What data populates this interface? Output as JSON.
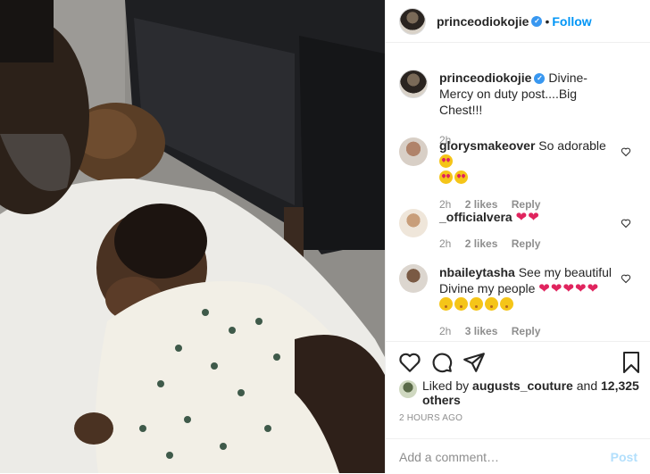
{
  "header": {
    "username": "princeodiokojie",
    "verified_icon": "verified-badge-icon",
    "separator": "•",
    "follow_label": "Follow"
  },
  "caption": {
    "username": "princeodiokojie",
    "text": "Divine-Mercy on duty post....Big Chest!!!",
    "time": "2h"
  },
  "comments": [
    {
      "username": "glorysmakeover",
      "text": "So adorable",
      "emoji": [
        "heart-eyes-emoji",
        "heart-eyes-emoji",
        "heart-eyes-emoji"
      ],
      "time": "2h",
      "likes": "2 likes",
      "reply": "Reply"
    },
    {
      "username": "_officialvera",
      "text": "",
      "emoji": [
        "red-heart-emoji",
        "red-heart-emoji"
      ],
      "time": "2h",
      "likes": "2 likes",
      "reply": "Reply"
    },
    {
      "username": "nbaileytasha",
      "text": "See my beautiful Divine my people",
      "emoji": [
        "red-heart-emoji",
        "red-heart-emoji",
        "red-heart-emoji",
        "red-heart-emoji",
        "red-heart-emoji",
        "kissing-emoji",
        "kissing-emoji",
        "kissing-emoji",
        "kissing-emoji",
        "kissing-emoji"
      ],
      "time": "2h",
      "likes": "3 likes",
      "reply": "Reply"
    }
  ],
  "actions": {
    "like_icon": "heart-outline-icon",
    "comment_icon": "comment-bubble-icon",
    "share_icon": "paper-plane-icon",
    "save_icon": "bookmark-icon"
  },
  "likes": {
    "prefix": "Liked by",
    "user": "augusts_couture",
    "mid": "and",
    "count": "12,325 others"
  },
  "timestamp": "2 HOURS AGO",
  "add_comment": {
    "placeholder": "Add a comment…",
    "post_label": "Post"
  },
  "colors": {
    "accent": "#0095f6",
    "post_disabled": "#b2dffc",
    "heart": "#e0245e",
    "verified": "#3897f0",
    "muted": "#8e8e8e"
  }
}
